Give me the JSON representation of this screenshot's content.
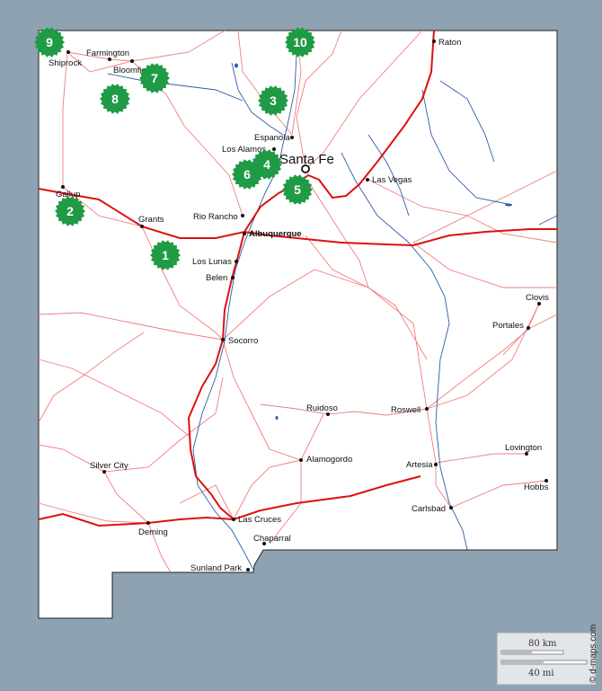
{
  "map": {
    "capital": "Santa Fe",
    "cities": {
      "raton": "Raton",
      "farmington": "Farmington",
      "shiprock": "Shiprock",
      "bloomfield": "Bloomfield",
      "espanola": "Espanola",
      "los_alamos": "Los Alamos",
      "las_vegas": "Las Vegas",
      "gallup": "Gallup",
      "grants": "Grants",
      "rio_rancho": "Rio Rancho",
      "albuquerque": "Albuquerque",
      "los_lunas": "Los Lunas",
      "belen": "Belen",
      "clovis": "Clovis",
      "portales": "Portales",
      "socorro": "Socorro",
      "ruidoso": "Ruidoso",
      "roswell": "Roswell",
      "lovington": "Lovington",
      "silver_city": "Silver City",
      "alamogordo": "Alamogordo",
      "artesia": "Artesia",
      "hobbs": "Hobbs",
      "carlsbad": "Carlsbad",
      "deming": "Deming",
      "las_cruces": "Las Cruces",
      "chaparral": "Chaparral",
      "sunland_park": "Sunland Park"
    },
    "markers": [
      "1",
      "2",
      "3",
      "4",
      "5",
      "6",
      "7",
      "8",
      "9",
      "10"
    ],
    "marker_color": "#1f9a45",
    "highway_color": "#dd1111",
    "road_color": "#f07d7d",
    "river_color": "#2a5ea8",
    "land_color": "#ffffff",
    "background_color": "#8fa2b1"
  },
  "scale": {
    "km": "80 km",
    "mi": "40 mi"
  },
  "credit": "© d-maps.com"
}
